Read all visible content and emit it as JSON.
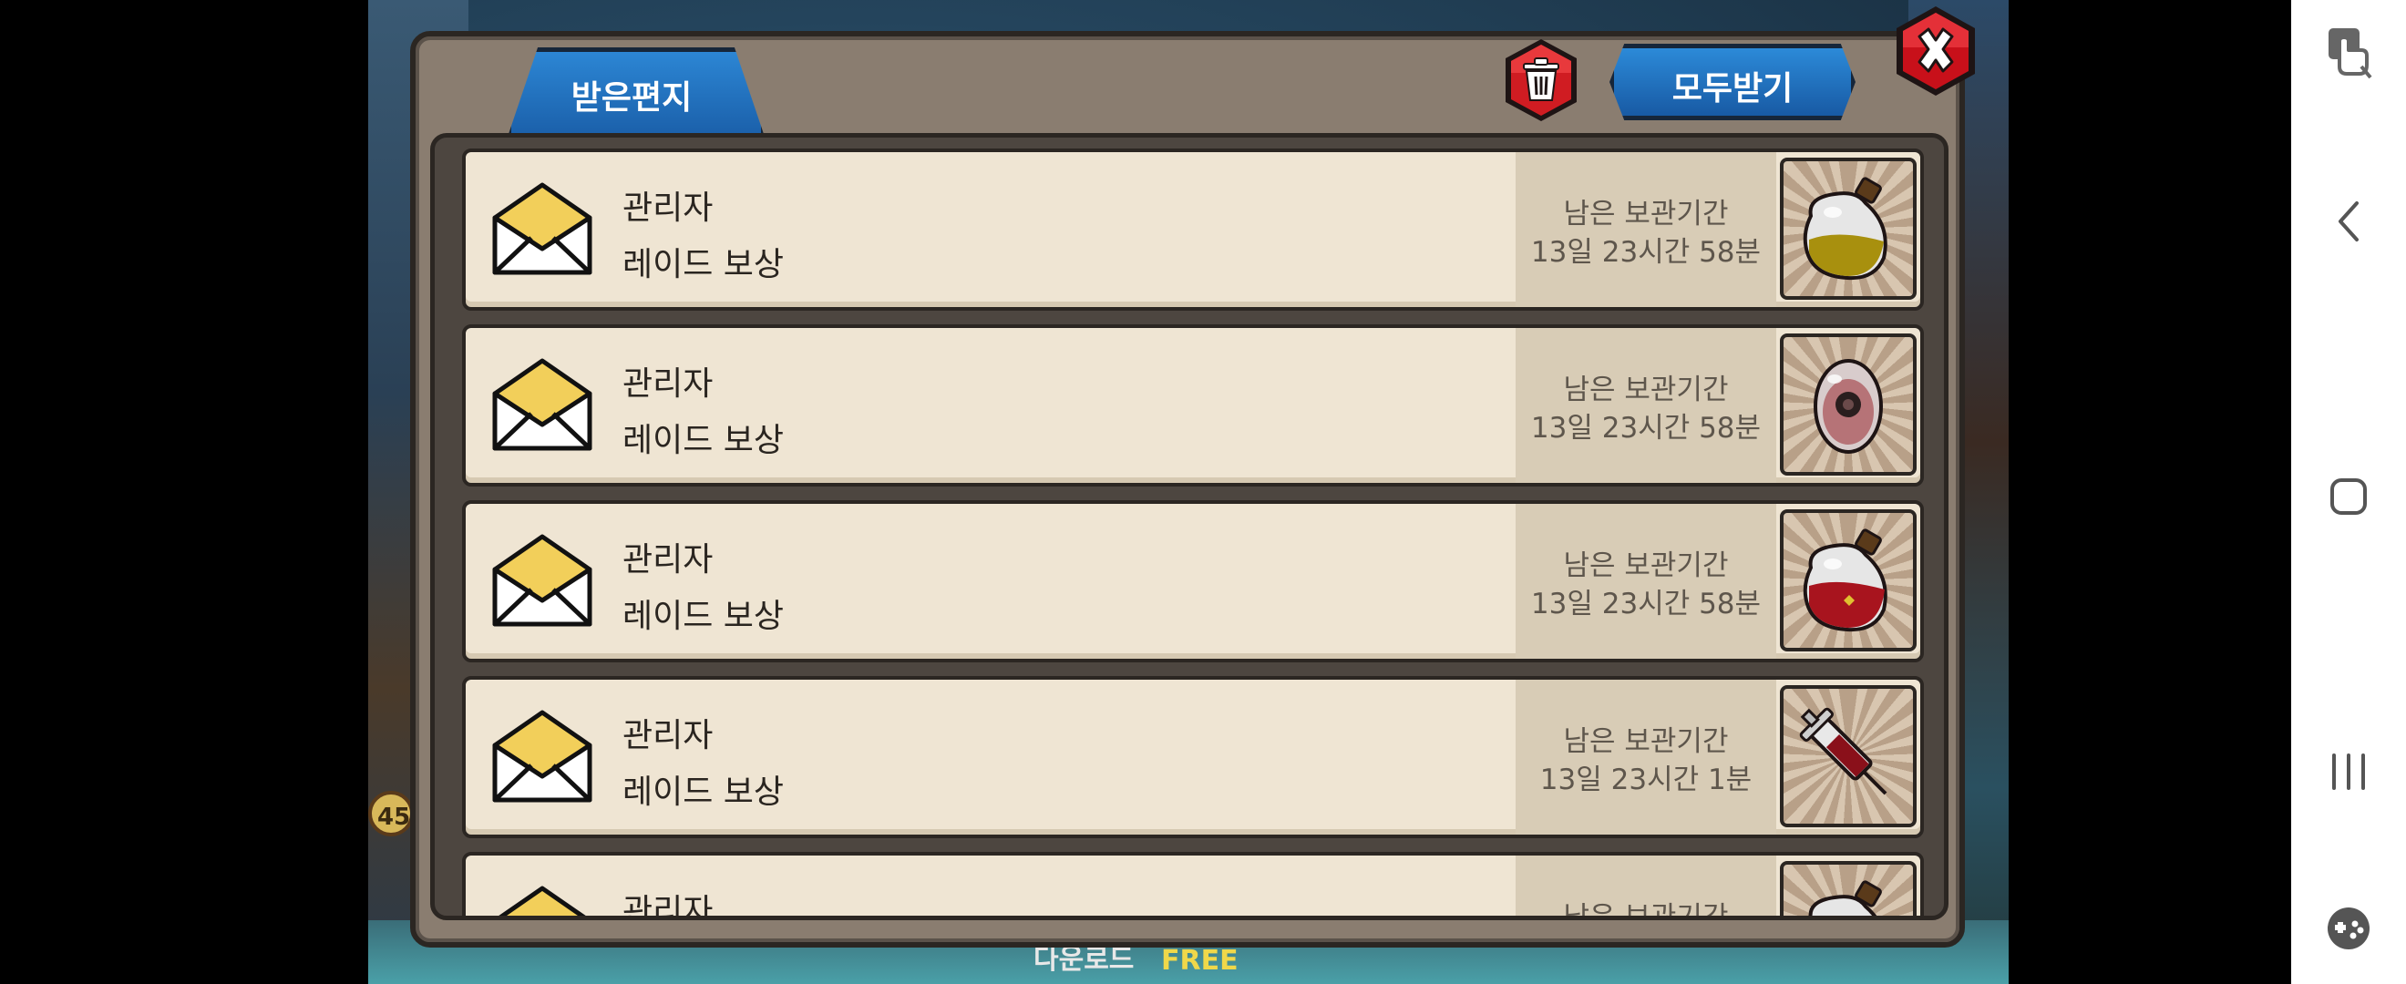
{
  "mailbox": {
    "tab_label": "받은편지",
    "receive_all_label": "모두받기",
    "messages": [
      {
        "sender": "관리자",
        "title": "레이드 보상",
        "remaining_label": "남은 보관기간",
        "remaining_time": "13일 23시간 58분",
        "item_icon": "yellow-potion-icon"
      },
      {
        "sender": "관리자",
        "title": "레이드 보상",
        "remaining_label": "남은 보관기간",
        "remaining_time": "13일 23시간 58분",
        "item_icon": "dark-egg-icon"
      },
      {
        "sender": "관리자",
        "title": "레이드 보상",
        "remaining_label": "남은 보관기간",
        "remaining_time": "13일 23시간 58분",
        "item_icon": "red-potion-icon"
      },
      {
        "sender": "관리자",
        "title": "레이드 보상",
        "remaining_label": "남은 보관기간",
        "remaining_time": "13일 23시간 1분",
        "item_icon": "syringe-icon"
      },
      {
        "sender": "관리자",
        "title": "",
        "remaining_label": "남은 보관기간",
        "remaining_time": "",
        "item_icon": "purple-potion-icon"
      }
    ]
  },
  "background": {
    "download_text": "다운로드",
    "free_text": "FREE",
    "level_badge": "45"
  },
  "colors": {
    "tab_blue": "#1a5ea8",
    "panel_brown": "#8a7d70",
    "row_cream": "#efe5d3",
    "close_red": "#c8101a"
  },
  "navbar": {
    "icons": [
      "game-tools-touch-icon",
      "back-icon",
      "home-icon",
      "recents-icon",
      "game-launcher-icon"
    ]
  }
}
